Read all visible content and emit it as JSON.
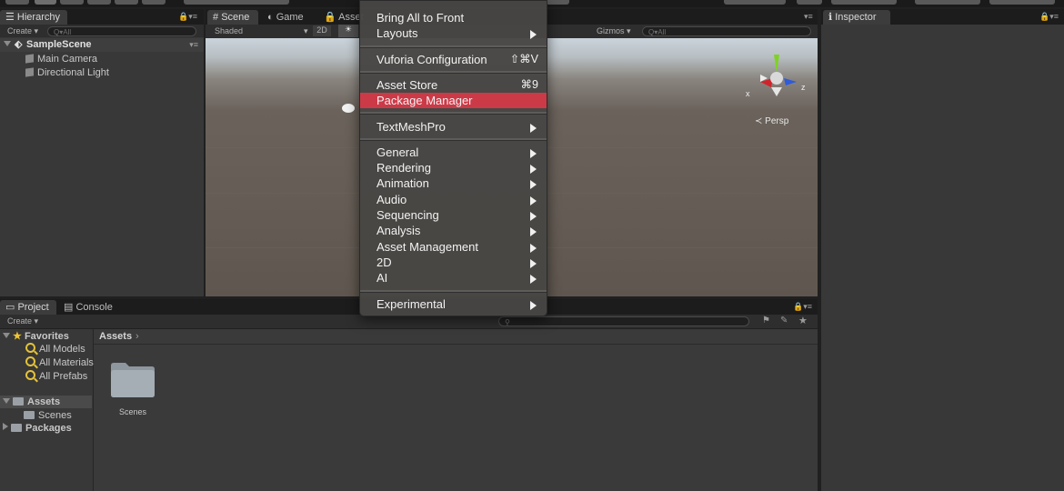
{
  "hierarchy": {
    "tab": "Hierarchy",
    "create_label": "Create ▾",
    "search_placeholder": "Q▾All",
    "scene_name": "SampleScene",
    "items": [
      "Main Camera",
      "Directional Light"
    ]
  },
  "scene_view": {
    "tabs": [
      "Scene",
      "Game",
      "Asset"
    ],
    "shading": "Shaded",
    "mode_2d": "2D",
    "gizmos_label": "Gizmos ▾",
    "gizmos_search_placeholder": "Q▾All",
    "persp_label": "≺ Persp",
    "axis_x": "x",
    "axis_z": "z"
  },
  "inspector": {
    "tab": "Inspector"
  },
  "project": {
    "tabs": [
      "Project",
      "Console"
    ],
    "create_label": "Create ▾",
    "favorites_label": "Favorites",
    "favorites": [
      "All Models",
      "All Materials",
      "All Prefabs"
    ],
    "assets_label": "Assets",
    "asset_children": [
      "Scenes"
    ],
    "packages_label": "Packages",
    "breadcrumb": "Assets",
    "folder_items": [
      "Scenes"
    ]
  },
  "menu": {
    "items": [
      {
        "label": "Bring All to Front",
        "shortcut": "",
        "submenu": false,
        "highlighted": false
      },
      {
        "label": "Layouts",
        "shortcut": "",
        "submenu": true,
        "highlighted": false
      },
      {
        "label": "Vuforia Configuration",
        "shortcut": "⇧⌘V",
        "submenu": false,
        "highlighted": false
      },
      {
        "label": "Asset Store",
        "shortcut": "⌘9",
        "submenu": false,
        "highlighted": false
      },
      {
        "label": "Package Manager",
        "shortcut": "",
        "submenu": false,
        "highlighted": true
      },
      {
        "label": "TextMeshPro",
        "shortcut": "",
        "submenu": true,
        "highlighted": false
      },
      {
        "label": "General",
        "shortcut": "",
        "submenu": true,
        "highlighted": false
      },
      {
        "label": "Rendering",
        "shortcut": "",
        "submenu": true,
        "highlighted": false
      },
      {
        "label": "Animation",
        "shortcut": "",
        "submenu": true,
        "highlighted": false
      },
      {
        "label": "Audio",
        "shortcut": "",
        "submenu": true,
        "highlighted": false
      },
      {
        "label": "Sequencing",
        "shortcut": "",
        "submenu": true,
        "highlighted": false
      },
      {
        "label": "Analysis",
        "shortcut": "",
        "submenu": true,
        "highlighted": false
      },
      {
        "label": "Asset Management",
        "shortcut": "",
        "submenu": true,
        "highlighted": false
      },
      {
        "label": "2D",
        "shortcut": "",
        "submenu": true,
        "highlighted": false
      },
      {
        "label": "AI",
        "shortcut": "",
        "submenu": true,
        "highlighted": false
      },
      {
        "label": "Experimental",
        "shortcut": "",
        "submenu": true,
        "highlighted": false
      }
    ],
    "highlight_color": "#cc3a48"
  }
}
